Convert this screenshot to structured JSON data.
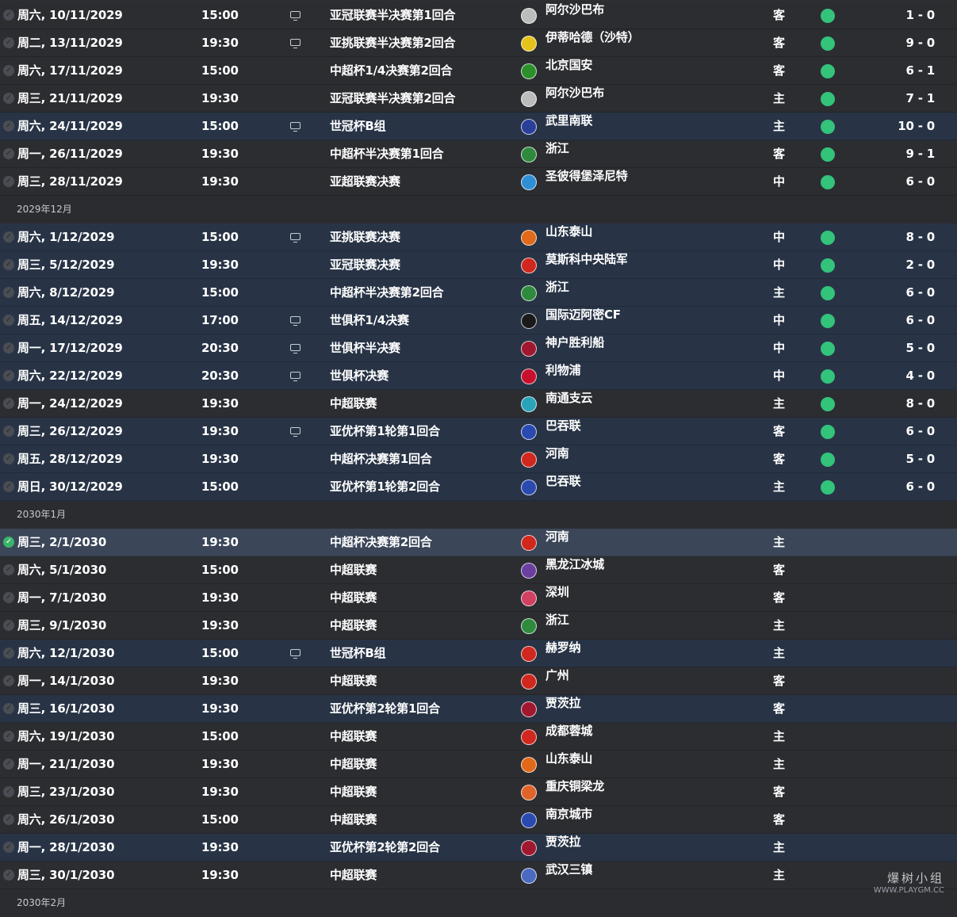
{
  "rows": [
    {
      "kind": "match",
      "date": "周六, 10/11/2029",
      "time": "15:00",
      "tv": true,
      "comp": "亚冠联赛半决赛第1回合",
      "opp": "阿尔沙巴布",
      "crest": "#bcbcbc",
      "venue": "客",
      "result": "win",
      "score": "1 - 0",
      "bg": "dark"
    },
    {
      "kind": "match",
      "date": "周二, 13/11/2029",
      "time": "19:30",
      "tv": true,
      "comp": "亚挑联赛半决赛第2回合",
      "opp": "伊蒂哈德（沙特）",
      "crest": "#e6c21a",
      "venue": "客",
      "result": "win",
      "score": "9 - 0",
      "bg": "dark"
    },
    {
      "kind": "match",
      "date": "周六, 17/11/2029",
      "time": "15:00",
      "tv": false,
      "comp": "中超杯1/4决赛第2回合",
      "opp": "北京国安",
      "crest": "#2c8f2c",
      "venue": "客",
      "result": "win",
      "score": "6 - 1",
      "bg": "dark"
    },
    {
      "kind": "match",
      "date": "周三, 21/11/2029",
      "time": "19:30",
      "tv": false,
      "comp": "亚冠联赛半决赛第2回合",
      "opp": "阿尔沙巴布",
      "crest": "#bcbcbc",
      "venue": "主",
      "result": "win",
      "score": "7 - 1",
      "bg": "dark"
    },
    {
      "kind": "match",
      "date": "周六, 24/11/2029",
      "time": "15:00",
      "tv": true,
      "comp": "世冠杯B组",
      "opp": "武里南联",
      "crest": "#2a3f9a",
      "venue": "主",
      "result": "win",
      "score": "10 - 0",
      "bg": "blue"
    },
    {
      "kind": "match",
      "date": "周一, 26/11/2029",
      "time": "19:30",
      "tv": false,
      "comp": "中超杯半决赛第1回合",
      "opp": "浙江",
      "crest": "#2f8a3e",
      "venue": "客",
      "result": "win",
      "score": "9 - 1",
      "bg": "dark"
    },
    {
      "kind": "match",
      "date": "周三, 28/11/2029",
      "time": "19:30",
      "tv": false,
      "comp": "亚超联赛决赛",
      "opp": "圣彼得堡泽尼特",
      "crest": "#2f8fd6",
      "venue": "中",
      "result": "win",
      "score": "6 - 0",
      "bg": "dark"
    },
    {
      "kind": "header",
      "label": "2029年12月"
    },
    {
      "kind": "match",
      "date": "周六, 1/12/2029",
      "time": "15:00",
      "tv": true,
      "comp": "亚挑联赛决赛",
      "opp": "山东泰山",
      "crest": "#e06a1a",
      "venue": "中",
      "result": "win",
      "score": "8 - 0",
      "bg": "blue"
    },
    {
      "kind": "match",
      "date": "周三, 5/12/2029",
      "time": "19:30",
      "tv": false,
      "comp": "亚冠联赛决赛",
      "opp": "莫斯科中央陆军",
      "crest": "#d0281e",
      "venue": "中",
      "result": "win",
      "score": "2 - 0",
      "bg": "blue"
    },
    {
      "kind": "match",
      "date": "周六, 8/12/2029",
      "time": "15:00",
      "tv": false,
      "comp": "中超杯半决赛第2回合",
      "opp": "浙江",
      "crest": "#2f8a3e",
      "venue": "主",
      "result": "win",
      "score": "6 - 0",
      "bg": "blue"
    },
    {
      "kind": "match",
      "date": "周五, 14/12/2029",
      "time": "17:00",
      "tv": true,
      "comp": "世俱杯1/4决赛",
      "opp": "国际迈阿密CF",
      "crest": "#1a1a1a",
      "venue": "中",
      "result": "win",
      "score": "6 - 0",
      "bg": "blue"
    },
    {
      "kind": "match",
      "date": "周一, 17/12/2029",
      "time": "20:30",
      "tv": true,
      "comp": "世俱杯半决赛",
      "opp": "神户胜利船",
      "crest": "#a01830",
      "venue": "中",
      "result": "win",
      "score": "5 - 0",
      "bg": "blue"
    },
    {
      "kind": "match",
      "date": "周六, 22/12/2029",
      "time": "20:30",
      "tv": true,
      "comp": "世俱杯决赛",
      "opp": "利物浦",
      "crest": "#c8102e",
      "venue": "中",
      "result": "win",
      "score": "4 - 0",
      "bg": "blue"
    },
    {
      "kind": "match",
      "date": "周一, 24/12/2029",
      "time": "19:30",
      "tv": false,
      "comp": "中超联赛",
      "opp": "南通支云",
      "crest": "#2aa3b8",
      "venue": "主",
      "result": "win",
      "score": "8 - 0",
      "bg": "dark"
    },
    {
      "kind": "match",
      "date": "周三, 26/12/2029",
      "time": "19:30",
      "tv": true,
      "comp": "亚优杯第1轮第1回合",
      "opp": "巴吞联",
      "crest": "#2a4ab0",
      "venue": "客",
      "result": "win",
      "score": "6 - 0",
      "bg": "blue"
    },
    {
      "kind": "match",
      "date": "周五, 28/12/2029",
      "time": "19:30",
      "tv": false,
      "comp": "中超杯决赛第1回合",
      "opp": "河南",
      "crest": "#d0281e",
      "venue": "客",
      "result": "win",
      "score": "5 - 0",
      "bg": "blue"
    },
    {
      "kind": "match",
      "date": "周日, 30/12/2029",
      "time": "15:00",
      "tv": false,
      "comp": "亚优杯第1轮第2回合",
      "opp": "巴吞联",
      "crest": "#2a4ab0",
      "venue": "主",
      "result": "win",
      "score": "6 - 0",
      "bg": "blue"
    },
    {
      "kind": "header",
      "label": "2030年1月"
    },
    {
      "kind": "match",
      "date": "周三, 2/1/2030",
      "time": "19:30",
      "tv": false,
      "comp": "中超杯决赛第2回合",
      "opp": "河南",
      "crest": "#d0281e",
      "venue": "主",
      "result": "",
      "score": "",
      "bg": "cur",
      "checked": true
    },
    {
      "kind": "match",
      "date": "周六, 5/1/2030",
      "time": "15:00",
      "tv": false,
      "comp": "中超联赛",
      "opp": "黑龙江冰城",
      "crest": "#6a3fa0",
      "venue": "客",
      "result": "",
      "score": "",
      "bg": "dark"
    },
    {
      "kind": "match",
      "date": "周一, 7/1/2030",
      "time": "19:30",
      "tv": false,
      "comp": "中超联赛",
      "opp": "深圳",
      "crest": "#d04060",
      "venue": "客",
      "result": "",
      "score": "",
      "bg": "dark"
    },
    {
      "kind": "match",
      "date": "周三, 9/1/2030",
      "time": "19:30",
      "tv": false,
      "comp": "中超联赛",
      "opp": "浙江",
      "crest": "#2f8a3e",
      "venue": "主",
      "result": "",
      "score": "",
      "bg": "dark"
    },
    {
      "kind": "match",
      "date": "周六, 12/1/2030",
      "time": "15:00",
      "tv": true,
      "comp": "世冠杯B组",
      "opp": "赫罗纳",
      "crest": "#d0281e",
      "venue": "主",
      "result": "",
      "score": "",
      "bg": "blue"
    },
    {
      "kind": "match",
      "date": "周一, 14/1/2030",
      "time": "19:30",
      "tv": false,
      "comp": "中超联赛",
      "opp": "广州",
      "crest": "#d0281e",
      "venue": "客",
      "result": "",
      "score": "",
      "bg": "dark"
    },
    {
      "kind": "match",
      "date": "周三, 16/1/2030",
      "time": "19:30",
      "tv": false,
      "comp": "亚优杯第2轮第1回合",
      "opp": "贾茨拉",
      "crest": "#a01830",
      "venue": "客",
      "result": "",
      "score": "",
      "bg": "blue"
    },
    {
      "kind": "match",
      "date": "周六, 19/1/2030",
      "time": "15:00",
      "tv": false,
      "comp": "中超联赛",
      "opp": "成都蓉城",
      "crest": "#d0281e",
      "venue": "主",
      "result": "",
      "score": "",
      "bg": "dark"
    },
    {
      "kind": "match",
      "date": "周一, 21/1/2030",
      "time": "19:30",
      "tv": false,
      "comp": "中超联赛",
      "opp": "山东泰山",
      "crest": "#e06a1a",
      "venue": "主",
      "result": "",
      "score": "",
      "bg": "dark"
    },
    {
      "kind": "match",
      "date": "周三, 23/1/2030",
      "time": "19:30",
      "tv": false,
      "comp": "中超联赛",
      "opp": "重庆铜梁龙",
      "crest": "#e0642a",
      "venue": "客",
      "result": "",
      "score": "",
      "bg": "dark"
    },
    {
      "kind": "match",
      "date": "周六, 26/1/2030",
      "time": "15:00",
      "tv": false,
      "comp": "中超联赛",
      "opp": "南京城市",
      "crest": "#2a4ab0",
      "venue": "客",
      "result": "",
      "score": "",
      "bg": "dark"
    },
    {
      "kind": "match",
      "date": "周一, 28/1/2030",
      "time": "19:30",
      "tv": false,
      "comp": "亚优杯第2轮第2回合",
      "opp": "贾茨拉",
      "crest": "#a01830",
      "venue": "主",
      "result": "",
      "score": "",
      "bg": "blue"
    },
    {
      "kind": "match",
      "date": "周三, 30/1/2030",
      "time": "19:30",
      "tv": false,
      "comp": "中超联赛",
      "opp": "武汉三镇",
      "crest": "#4a6ac0",
      "venue": "主",
      "result": "",
      "score": "",
      "bg": "dark"
    },
    {
      "kind": "header",
      "label": "2030年2月"
    }
  ],
  "watermark": {
    "name": "爆树小组",
    "url": "WWW.PLAYGM.CC"
  },
  "colors": {
    "win": "#33c37a",
    "row_dark": "#2c2d31",
    "row_blue": "#283446",
    "row_current": "#3b4659"
  }
}
